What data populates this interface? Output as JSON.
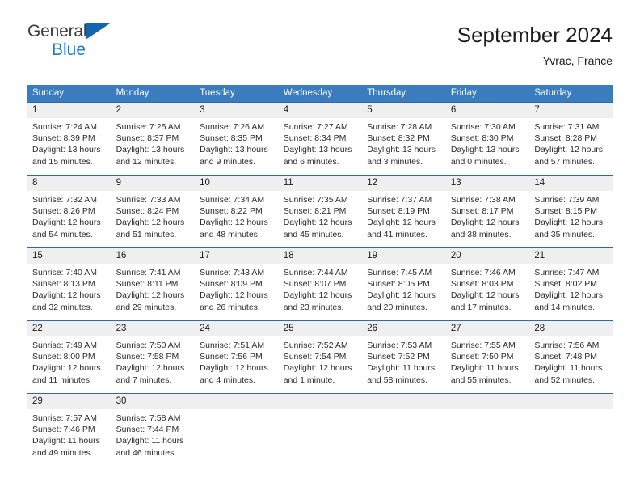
{
  "brand": {
    "name_part1": "General",
    "name_part2": "Blue",
    "triangle_color": "#1565b0",
    "blue_text_color": "#1a7bc4"
  },
  "header": {
    "title": "September 2024",
    "subtitle": "Yvrac, France"
  },
  "theme": {
    "header_bar_color": "#3b7cbf",
    "row_border_color": "#2a6ba8",
    "daynum_background": "#efefef"
  },
  "weekday_headers": [
    "Sunday",
    "Monday",
    "Tuesday",
    "Wednesday",
    "Thursday",
    "Friday",
    "Saturday"
  ],
  "weeks": [
    [
      {
        "day": "1",
        "sunrise": "Sunrise: 7:24 AM",
        "sunset": "Sunset: 8:39 PM",
        "daylight_line1": "Daylight: 13 hours",
        "daylight_line2": "and 15 minutes."
      },
      {
        "day": "2",
        "sunrise": "Sunrise: 7:25 AM",
        "sunset": "Sunset: 8:37 PM",
        "daylight_line1": "Daylight: 13 hours",
        "daylight_line2": "and 12 minutes."
      },
      {
        "day": "3",
        "sunrise": "Sunrise: 7:26 AM",
        "sunset": "Sunset: 8:35 PM",
        "daylight_line1": "Daylight: 13 hours",
        "daylight_line2": "and 9 minutes."
      },
      {
        "day": "4",
        "sunrise": "Sunrise: 7:27 AM",
        "sunset": "Sunset: 8:34 PM",
        "daylight_line1": "Daylight: 13 hours",
        "daylight_line2": "and 6 minutes."
      },
      {
        "day": "5",
        "sunrise": "Sunrise: 7:28 AM",
        "sunset": "Sunset: 8:32 PM",
        "daylight_line1": "Daylight: 13 hours",
        "daylight_line2": "and 3 minutes."
      },
      {
        "day": "6",
        "sunrise": "Sunrise: 7:30 AM",
        "sunset": "Sunset: 8:30 PM",
        "daylight_line1": "Daylight: 13 hours",
        "daylight_line2": "and 0 minutes."
      },
      {
        "day": "7",
        "sunrise": "Sunrise: 7:31 AM",
        "sunset": "Sunset: 8:28 PM",
        "daylight_line1": "Daylight: 12 hours",
        "daylight_line2": "and 57 minutes."
      }
    ],
    [
      {
        "day": "8",
        "sunrise": "Sunrise: 7:32 AM",
        "sunset": "Sunset: 8:26 PM",
        "daylight_line1": "Daylight: 12 hours",
        "daylight_line2": "and 54 minutes."
      },
      {
        "day": "9",
        "sunrise": "Sunrise: 7:33 AM",
        "sunset": "Sunset: 8:24 PM",
        "daylight_line1": "Daylight: 12 hours",
        "daylight_line2": "and 51 minutes."
      },
      {
        "day": "10",
        "sunrise": "Sunrise: 7:34 AM",
        "sunset": "Sunset: 8:22 PM",
        "daylight_line1": "Daylight: 12 hours",
        "daylight_line2": "and 48 minutes."
      },
      {
        "day": "11",
        "sunrise": "Sunrise: 7:35 AM",
        "sunset": "Sunset: 8:21 PM",
        "daylight_line1": "Daylight: 12 hours",
        "daylight_line2": "and 45 minutes."
      },
      {
        "day": "12",
        "sunrise": "Sunrise: 7:37 AM",
        "sunset": "Sunset: 8:19 PM",
        "daylight_line1": "Daylight: 12 hours",
        "daylight_line2": "and 41 minutes."
      },
      {
        "day": "13",
        "sunrise": "Sunrise: 7:38 AM",
        "sunset": "Sunset: 8:17 PM",
        "daylight_line1": "Daylight: 12 hours",
        "daylight_line2": "and 38 minutes."
      },
      {
        "day": "14",
        "sunrise": "Sunrise: 7:39 AM",
        "sunset": "Sunset: 8:15 PM",
        "daylight_line1": "Daylight: 12 hours",
        "daylight_line2": "and 35 minutes."
      }
    ],
    [
      {
        "day": "15",
        "sunrise": "Sunrise: 7:40 AM",
        "sunset": "Sunset: 8:13 PM",
        "daylight_line1": "Daylight: 12 hours",
        "daylight_line2": "and 32 minutes."
      },
      {
        "day": "16",
        "sunrise": "Sunrise: 7:41 AM",
        "sunset": "Sunset: 8:11 PM",
        "daylight_line1": "Daylight: 12 hours",
        "daylight_line2": "and 29 minutes."
      },
      {
        "day": "17",
        "sunrise": "Sunrise: 7:43 AM",
        "sunset": "Sunset: 8:09 PM",
        "daylight_line1": "Daylight: 12 hours",
        "daylight_line2": "and 26 minutes."
      },
      {
        "day": "18",
        "sunrise": "Sunrise: 7:44 AM",
        "sunset": "Sunset: 8:07 PM",
        "daylight_line1": "Daylight: 12 hours",
        "daylight_line2": "and 23 minutes."
      },
      {
        "day": "19",
        "sunrise": "Sunrise: 7:45 AM",
        "sunset": "Sunset: 8:05 PM",
        "daylight_line1": "Daylight: 12 hours",
        "daylight_line2": "and 20 minutes."
      },
      {
        "day": "20",
        "sunrise": "Sunrise: 7:46 AM",
        "sunset": "Sunset: 8:03 PM",
        "daylight_line1": "Daylight: 12 hours",
        "daylight_line2": "and 17 minutes."
      },
      {
        "day": "21",
        "sunrise": "Sunrise: 7:47 AM",
        "sunset": "Sunset: 8:02 PM",
        "daylight_line1": "Daylight: 12 hours",
        "daylight_line2": "and 14 minutes."
      }
    ],
    [
      {
        "day": "22",
        "sunrise": "Sunrise: 7:49 AM",
        "sunset": "Sunset: 8:00 PM",
        "daylight_line1": "Daylight: 12 hours",
        "daylight_line2": "and 11 minutes."
      },
      {
        "day": "23",
        "sunrise": "Sunrise: 7:50 AM",
        "sunset": "Sunset: 7:58 PM",
        "daylight_line1": "Daylight: 12 hours",
        "daylight_line2": "and 7 minutes."
      },
      {
        "day": "24",
        "sunrise": "Sunrise: 7:51 AM",
        "sunset": "Sunset: 7:56 PM",
        "daylight_line1": "Daylight: 12 hours",
        "daylight_line2": "and 4 minutes."
      },
      {
        "day": "25",
        "sunrise": "Sunrise: 7:52 AM",
        "sunset": "Sunset: 7:54 PM",
        "daylight_line1": "Daylight: 12 hours",
        "daylight_line2": "and 1 minute."
      },
      {
        "day": "26",
        "sunrise": "Sunrise: 7:53 AM",
        "sunset": "Sunset: 7:52 PM",
        "daylight_line1": "Daylight: 11 hours",
        "daylight_line2": "and 58 minutes."
      },
      {
        "day": "27",
        "sunrise": "Sunrise: 7:55 AM",
        "sunset": "Sunset: 7:50 PM",
        "daylight_line1": "Daylight: 11 hours",
        "daylight_line2": "and 55 minutes."
      },
      {
        "day": "28",
        "sunrise": "Sunrise: 7:56 AM",
        "sunset": "Sunset: 7:48 PM",
        "daylight_line1": "Daylight: 11 hours",
        "daylight_line2": "and 52 minutes."
      }
    ],
    [
      {
        "day": "29",
        "sunrise": "Sunrise: 7:57 AM",
        "sunset": "Sunset: 7:46 PM",
        "daylight_line1": "Daylight: 11 hours",
        "daylight_line2": "and 49 minutes."
      },
      {
        "day": "30",
        "sunrise": "Sunrise: 7:58 AM",
        "sunset": "Sunset: 7:44 PM",
        "daylight_line1": "Daylight: 11 hours",
        "daylight_line2": "and 46 minutes."
      },
      {
        "day": "",
        "sunrise": "",
        "sunset": "",
        "daylight_line1": "",
        "daylight_line2": ""
      },
      {
        "day": "",
        "sunrise": "",
        "sunset": "",
        "daylight_line1": "",
        "daylight_line2": ""
      },
      {
        "day": "",
        "sunrise": "",
        "sunset": "",
        "daylight_line1": "",
        "daylight_line2": ""
      },
      {
        "day": "",
        "sunrise": "",
        "sunset": "",
        "daylight_line1": "",
        "daylight_line2": ""
      },
      {
        "day": "",
        "sunrise": "",
        "sunset": "",
        "daylight_line1": "",
        "daylight_line2": ""
      }
    ]
  ]
}
